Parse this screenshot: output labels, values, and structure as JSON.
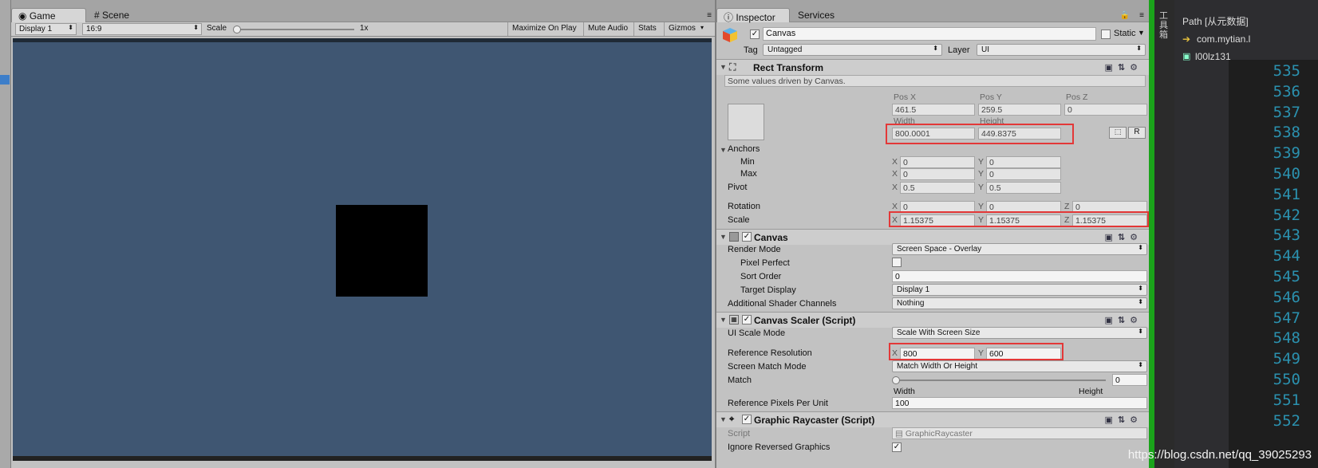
{
  "game": {
    "tabs": [
      {
        "label": "Game"
      },
      {
        "label": "Scene"
      }
    ],
    "display": "Display 1",
    "aspect": "16:9",
    "scale_label": "Scale",
    "scale_value": "1x",
    "buttons": {
      "maximize": "Maximize On Play",
      "mute": "Mute Audio",
      "stats": "Stats",
      "gizmos": "Gizmos"
    }
  },
  "inspector": {
    "tabs": {
      "inspector": "Inspector",
      "services": "Services"
    },
    "object_name": "Canvas",
    "static_label": "Static",
    "tag_label": "Tag",
    "tag_value": "Untagged",
    "layer_label": "Layer",
    "layer_value": "UI",
    "rect": {
      "title": "Rect Transform",
      "note": "Some values driven by Canvas.",
      "posx_label": "Pos X",
      "posy_label": "Pos Y",
      "posz_label": "Pos Z",
      "posx": "461.5",
      "posy": "259.5",
      "posz": "0",
      "width_label": "Width",
      "height_label": "Height",
      "width": "800.0001",
      "height": "449.8375",
      "anchors_label": "Anchors",
      "min_label": "Min",
      "max_label": "Max",
      "min_x": "0",
      "min_y": "0",
      "max_x": "0",
      "max_y": "0",
      "pivot_label": "Pivot",
      "pivot_x": "0.5",
      "pivot_y": "0.5",
      "rotation_label": "Rotation",
      "rot_x": "0",
      "rot_y": "0",
      "rot_z": "0",
      "scale_label": "Scale",
      "scale_x": "1.15375",
      "scale_y": "1.15375",
      "scale_z": "1.15375",
      "r_button": "R"
    },
    "canvas": {
      "title": "Canvas",
      "render_mode_label": "Render Mode",
      "render_mode": "Screen Space - Overlay",
      "pixel_perfect_label": "Pixel Perfect",
      "sort_order_label": "Sort Order",
      "sort_order": "0",
      "target_display_label": "Target Display",
      "target_display": "Display 1",
      "shader_label": "Additional Shader Channels",
      "shader": "Nothing"
    },
    "scaler": {
      "title": "Canvas Scaler (Script)",
      "ui_scale_label": "UI Scale Mode",
      "ui_scale": "Scale With Screen Size",
      "ref_res_label": "Reference Resolution",
      "ref_x": "800",
      "ref_y": "600",
      "match_mode_label": "Screen Match Mode",
      "match_mode": "Match Width Or Height",
      "match_label": "Match",
      "match_value": "0",
      "width_word": "Width",
      "height_word": "Height",
      "rppu_label": "Reference Pixels Per Unit",
      "rppu": "100"
    },
    "raycaster": {
      "title": "Graphic Raycaster (Script)",
      "script_label": "Script",
      "script": "GraphicRaycaster",
      "ignore_label": "Ignore Reversed Graphics"
    }
  },
  "right": {
    "side_tab": "工具箱",
    "path_label": "Path [从元数据]",
    "item1": "com.mytian.l",
    "item2": "l00lz131",
    "line_numbers": [
      "535",
      "536",
      "537",
      "538",
      "539",
      "540",
      "541",
      "542",
      "543",
      "544",
      "545",
      "546",
      "547",
      "548",
      "549",
      "550",
      "551",
      "552"
    ]
  },
  "watermark": "https://blog.csdn.net/qq_39025293"
}
